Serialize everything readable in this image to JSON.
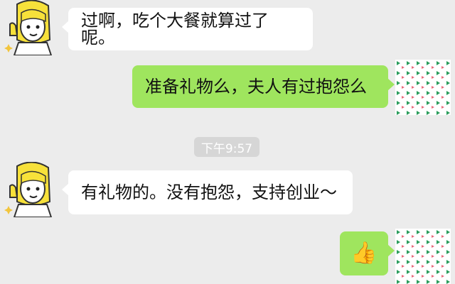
{
  "messages": [
    {
      "side": "left",
      "text": "过啊，吃个大餐就算过了呢。"
    },
    {
      "side": "right",
      "text": "准备礼物么，夫人有过抱怨么"
    },
    {
      "side": "left",
      "text": "有礼物的。没有抱怨，支持创业～"
    },
    {
      "side": "right",
      "emoji": "👍",
      "emoji_name": "thumbs-up-emoji"
    }
  ],
  "timestamp": "下午9:57",
  "colors": {
    "background": "#ececec",
    "left_bubble": "#ffffff",
    "right_bubble": "#9fe55e",
    "timestamp_bg": "#d6d6d6"
  },
  "avatars": {
    "left": "cartoon-thumbs-up-sticker-avatar",
    "right": "triangle-pattern-avatar"
  }
}
